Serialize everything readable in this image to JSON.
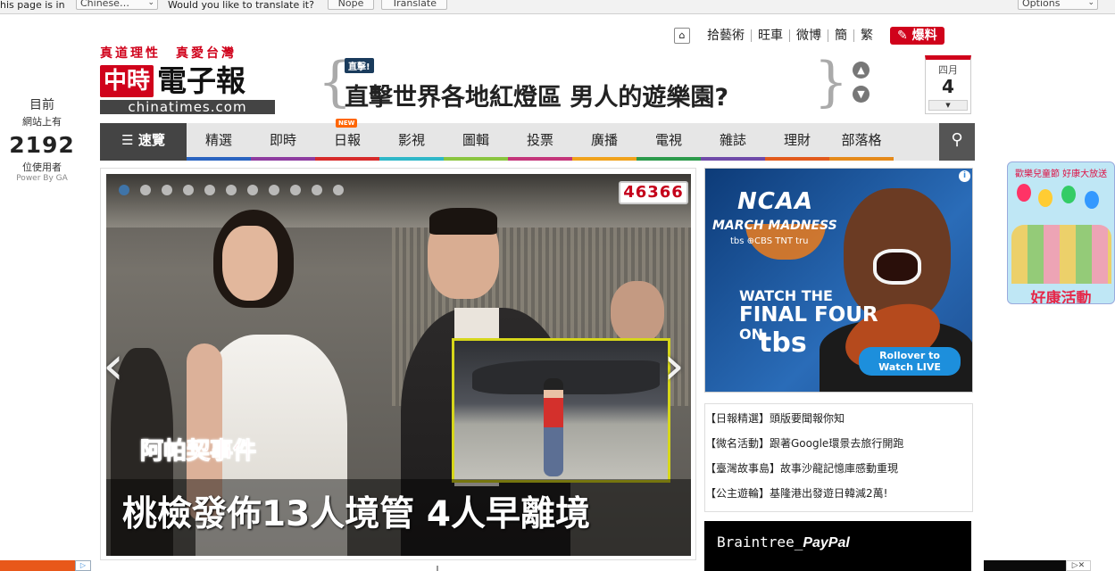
{
  "translate_bar": {
    "text_left": "his page is in",
    "language": "Chinese…",
    "question": "Would you like to translate it?",
    "nope": "Nope",
    "translate": "Translate",
    "options": "Options"
  },
  "visitors": {
    "line1": "目前",
    "line2": "網站上有",
    "count": "2192",
    "line3": "位使用者",
    "powered": "Power By GA"
  },
  "logo": {
    "slogan": "真道理性　真愛台灣",
    "red": "中時",
    "black": "電子報",
    "domain": "chinatimes.com"
  },
  "ticker": {
    "badge": "直擊!",
    "headline": "直擊世界各地紅燈區 男人的遊樂園?"
  },
  "date": {
    "month": "四月",
    "day": "4"
  },
  "top_links": {
    "items": [
      "拾藝術",
      "旺車",
      "微博",
      "簡",
      "繁"
    ],
    "baoliao": "爆料"
  },
  "nav": {
    "speed": "速覽",
    "items": [
      "精選",
      "即時",
      "日報",
      "影視",
      "圖輯",
      "投票",
      "廣播",
      "電視",
      "雜誌",
      "理財",
      "部落格"
    ],
    "new_tag": "NEW",
    "stripe_colors": [
      "#2a64c0",
      "#8e3ca0",
      "#d72b2b",
      "#2fb7c8",
      "#8ac53f",
      "#c4357a",
      "#f0a21c",
      "#2c9a4b",
      "#6f4aa8",
      "#e25a1c",
      "#e58a1b"
    ]
  },
  "slideshow": {
    "counter": "46366",
    "tag": "阿帕契事件",
    "caption": "桃檢發佈13人境管 4人早離境",
    "dot_count": 11
  },
  "ad": {
    "ncaa": "NCAA",
    "march": "MARCH MADNESS",
    "networks": "tbs ⊕CBS TNT tru",
    "watch": "WATCH THE",
    "final": "FINAL FOUR",
    "on": "ON",
    "tbs": "tbs",
    "rollover": "Rollover to",
    "watch_live": "Watch LIVE"
  },
  "promo_list": [
    "【日報精選】頭版要聞報你知",
    "【微名活動】跟著Google環景去旅行開跑",
    "【臺灣故事島】故事沙龍記憶庫感動重現",
    "【公主遊輪】基隆港出發遊日韓減2萬!"
  ],
  "ad2": {
    "text": "Braintree_",
    "brand": "PayPal"
  },
  "side_promo": {
    "top": "歡樂兒童節 好康大放送",
    "title": "好康活動"
  }
}
